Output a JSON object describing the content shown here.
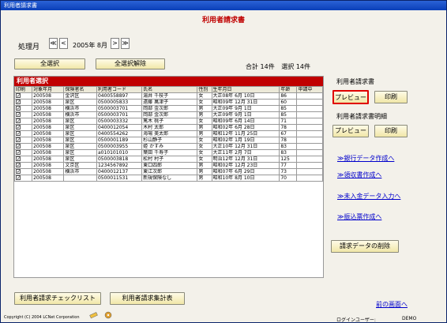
{
  "window": {
    "title": "利用者請求書"
  },
  "header": {
    "title": "利用者請求書"
  },
  "period": {
    "label": "処理月",
    "prev_prev": "≪",
    "prev": "<",
    "value": "2005年 8月",
    "next": ">",
    "next_next": "≫"
  },
  "selection": {
    "select_all": "全選択",
    "deselect_all": "全選択解除"
  },
  "totals": {
    "count_text": "合計 14件",
    "selected_text": "選択 14件"
  },
  "list": {
    "title": "利用者選択",
    "columns": [
      "印刷",
      "対象年月",
      "保険者名",
      "利用者コード",
      "氏名",
      "性別",
      "生年月日",
      "年齢",
      "申請中"
    ],
    "rows": [
      [
        "✓",
        "200508",
        "金沢区",
        "0400558897",
        "湯井 千枝子",
        "女",
        "大正08年 6月 10日",
        "86",
        ""
      ],
      [
        "✓",
        "200508",
        "泉区",
        "0500005833",
        "遠藤 萬津子",
        "女",
        "昭和09年 12月 31日",
        "60",
        ""
      ],
      [
        "✓",
        "200508",
        "横浜市",
        "0500003701",
        "岡部 金次郎",
        "男",
        "大正09年 9月 1日",
        "85",
        ""
      ],
      [
        "✓",
        "200508",
        "横浜市",
        "0500003701",
        "岡部 金次郎",
        "男",
        "大正09年 9月 1日",
        "85",
        ""
      ],
      [
        "✓",
        "200508",
        "泉区",
        "0500003332",
        "篤木 桃子",
        "女",
        "昭和09年 6月 14日",
        "71",
        ""
      ],
      [
        "✓",
        "200508",
        "泉区",
        "0400012054",
        "木村 太郎",
        "男",
        "昭和02年 6月 28日",
        "78",
        ""
      ],
      [
        "✓",
        "200508",
        "泉区",
        "0400554262",
        "海場 美太郎",
        "男",
        "昭和12年 11月 25日",
        "67",
        ""
      ],
      [
        "✓",
        "200508",
        "泉区",
        "0500001189",
        "杉山静子",
        "女",
        "昭和02年 1月 19日",
        "78",
        ""
      ],
      [
        "✓",
        "200508",
        "泉区",
        "0500003955",
        "姫 かすみ",
        "女",
        "大正10年 12月 31日",
        "83",
        ""
      ],
      [
        "✓",
        "200508",
        "泉区",
        "a010101010",
        "葉田 千寿子",
        "女",
        "大正11年 2月 7日",
        "83",
        ""
      ],
      [
        "✓",
        "200508",
        "泉区",
        "0500003818",
        "松村 村子",
        "女",
        "明治12年 12月 31日",
        "125",
        ""
      ],
      [
        "✓",
        "200508",
        "文京区",
        "1234567892",
        "東口四郎",
        "男",
        "昭和02年 12月 23日",
        "77",
        ""
      ],
      [
        "✓",
        "200508",
        "横浜市",
        "0400012137",
        "東江次郎",
        "男",
        "昭和07年 6月 29日",
        "73",
        ""
      ],
      [
        "✓",
        "200508",
        "",
        "0500011531",
        "新規保険なし",
        "男",
        "昭和10年 8月 10日",
        "70",
        ""
      ]
    ]
  },
  "sidebar": {
    "bill_label": "利用者請求書",
    "bill_preview": "プレビュー",
    "bill_print": "印刷",
    "detail_label": "利用者請求書明細",
    "detail_preview": "プレビュー",
    "detail_print": "印刷",
    "links": [
      "≫銀行データ作成へ",
      "≫領収書作成へ",
      "≫未入金データ入力へ",
      "≫振込票作成へ"
    ],
    "delete_button": "請求データの削除",
    "prev_screen": "前の画面へ"
  },
  "footer": {
    "check_list": "利用者請求チェックリスト",
    "summary_table": "利用者請求集計表",
    "copyright": "Copyright (C) 2004 LCNet Corporation",
    "login_label": "ログインユーザー:",
    "login_value": "DEMO"
  },
  "colors": {
    "accent": "#c00000",
    "link": "#0000cc",
    "highlight": "#e00000"
  },
  "icons": [
    "pencil-icon",
    "disk-icon"
  ]
}
